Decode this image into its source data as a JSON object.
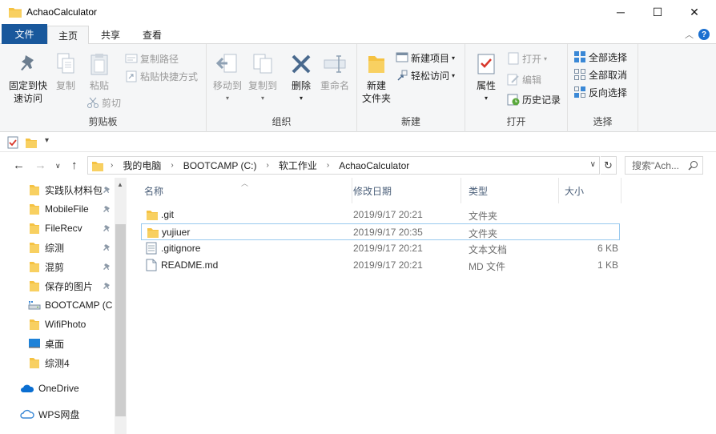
{
  "window": {
    "title": "AchaoCalculator"
  },
  "window_controls": {
    "minimize": "─",
    "maximize": "☐",
    "close": "✕"
  },
  "tabs": [
    {
      "label": "文件"
    },
    {
      "label": "主页"
    },
    {
      "label": "共享"
    },
    {
      "label": "查看"
    }
  ],
  "ribbon": {
    "clipboard": {
      "label": "剪贴板",
      "pin_quick_access": [
        "固定到快",
        "速访问"
      ],
      "copy": "复制",
      "paste": "粘贴",
      "copy_path": "复制路径",
      "paste_shortcut": "粘贴快捷方式",
      "cut": "剪切"
    },
    "organize": {
      "label": "组织",
      "move_to": "移动到",
      "copy_to": "复制到",
      "delete": "删除",
      "rename": "重命名"
    },
    "new": {
      "label": "新建",
      "new_folder": [
        "新建",
        "文件夹"
      ],
      "new_item": "新建项目",
      "easy_access": "轻松访问"
    },
    "open": {
      "label": "打开",
      "properties": "属性",
      "open": "打开",
      "edit": "编辑",
      "history": "历史记录"
    },
    "select": {
      "label": "选择",
      "select_all": "全部选择",
      "select_none": "全部取消",
      "invert": "反向选择"
    }
  },
  "address": {
    "crumbs": [
      "我的电脑",
      "BOOTCAMP (C:)",
      "软工作业",
      "AchaoCalculator"
    ],
    "search_placeholder": "搜索\"Ach..."
  },
  "nav_pane": {
    "items": [
      {
        "label": "实践队材料包",
        "icon": "folder-icon",
        "pinned": true
      },
      {
        "label": "MobileFile",
        "icon": "folder-icon",
        "pinned": true
      },
      {
        "label": "FileRecv",
        "icon": "folder-icon",
        "pinned": true
      },
      {
        "label": "综测",
        "icon": "folder-icon",
        "pinned": true
      },
      {
        "label": "混剪",
        "icon": "folder-icon",
        "pinned": true
      },
      {
        "label": "保存的图片",
        "icon": "folder-icon",
        "pinned": true
      },
      {
        "label": "BOOTCAMP (C",
        "icon": "drive-icon",
        "pinned": false
      },
      {
        "label": "WifiPhoto",
        "icon": "folder-icon",
        "pinned": false
      },
      {
        "label": "桌面",
        "icon": "desktop-icon",
        "pinned": false
      },
      {
        "label": "综测4",
        "icon": "folder-icon",
        "pinned": false
      },
      {
        "label": "OneDrive",
        "icon": "onedrive-icon",
        "pinned": false
      },
      {
        "label": "WPS网盘",
        "icon": "cloud-icon",
        "pinned": false
      }
    ]
  },
  "file_list": {
    "columns": {
      "name": "名称",
      "modified": "修改日期",
      "type": "类型",
      "size": "大小"
    },
    "rows": [
      {
        "name": ".git",
        "modified": "2019/9/17 20:21",
        "type": "文件夹",
        "size": "",
        "icon": "folder-icon"
      },
      {
        "name": "yujiuer",
        "modified": "2019/9/17 20:35",
        "type": "文件夹",
        "size": "",
        "icon": "folder-icon",
        "selected": true
      },
      {
        "name": ".gitignore",
        "modified": "2019/9/17 20:21",
        "type": "文本文档",
        "size": "6 KB",
        "icon": "text-file-icon"
      },
      {
        "name": "README.md",
        "modified": "2019/9/17 20:21",
        "type": "MD 文件",
        "size": "1 KB",
        "icon": "file-icon"
      }
    ]
  },
  "colors": {
    "file_tab": "#19589c",
    "folder": "#f5c242",
    "selection_border": "#99c9ef",
    "header_text": "#4c607a"
  }
}
